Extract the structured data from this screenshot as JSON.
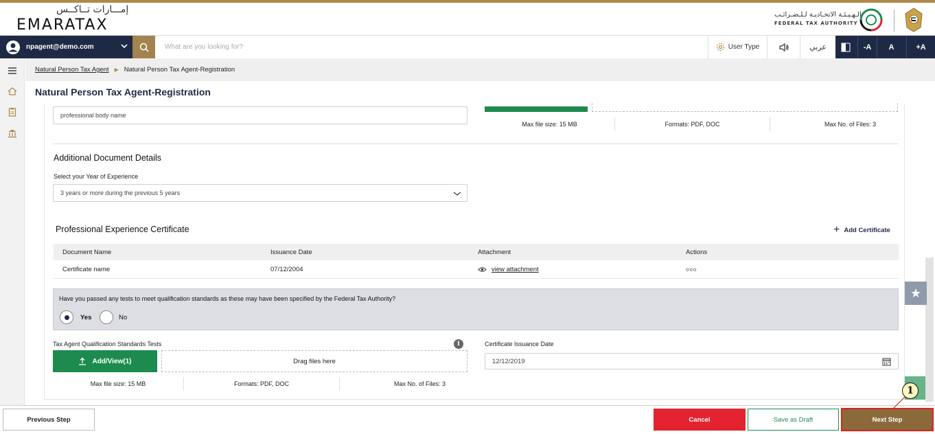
{
  "brand": {
    "logo_ar": "إمـــارات تــاكــس",
    "logo_en": "EMARATAX",
    "authority_ar": "الـهـيـئـة الاتحـاديـة لـلـضـرائـب",
    "authority_en": "FEDERAL TAX AUTHORITY"
  },
  "topbar": {
    "user_email": "npagent@demo.com",
    "search_placeholder": "What are you looking for?",
    "user_type_label": "User Type",
    "language_label": "عربي",
    "font_decrease": "-A",
    "font_reset": "A",
    "font_increase": "+A"
  },
  "breadcrumb": {
    "parent": "Natural Person Tax Agent",
    "current": "Natural Person Tax Agent-Registration"
  },
  "page_title": "Natural Person Tax Agent-Registration",
  "professional_body": {
    "placeholder_value": "professional body name"
  },
  "top_upload_meta": {
    "max_size": "Max file size: 15 MB",
    "formats": "Formats: PDF, DOC",
    "max_files": "Max No. of Files: 3"
  },
  "additional_docs": {
    "title": "Additional Document Details",
    "experience_label": "Select your Year of Experience",
    "experience_value": "3 years or more during the previous 5 years"
  },
  "certificates": {
    "title": "Professional Experience Certificate",
    "add_label": "Add Certificate",
    "columns": [
      "Document Name",
      "Issuance Date",
      "Attachment",
      "Actions"
    ],
    "rows": [
      {
        "name": "Certificate name",
        "date": "07/12/2004",
        "attachment": "view attachment",
        "actions": "ooo"
      }
    ]
  },
  "qualification_question": {
    "text": "Have you passed any tests to meet qualification standards as these may have been specified by the Federal Tax Authority?",
    "yes_label": "Yes",
    "no_label": "No",
    "selected": "Yes"
  },
  "standards_tests": {
    "label": "Tax Agent Qualification Standards Tests",
    "upload_label": "Add/View(1)",
    "drop_label": "Drag files here",
    "max_size": "Max file size: 15 MB",
    "formats": "Formats: PDF, DOC",
    "max_files": "Max No. of Files: 3"
  },
  "certificate_date": {
    "label": "Certificate Issuance Date",
    "value": "12/12/2019"
  },
  "footer": {
    "previous": "Previous Step",
    "cancel": "Cancel",
    "save_draft": "Save as Draft",
    "next": "Next Step"
  },
  "callout": {
    "number": "1"
  },
  "colors": {
    "navy": "#1e2a45",
    "gold": "#a2844e",
    "green": "#1d8b4e",
    "red": "#e3232f",
    "next_brown": "#8b6a3a"
  }
}
